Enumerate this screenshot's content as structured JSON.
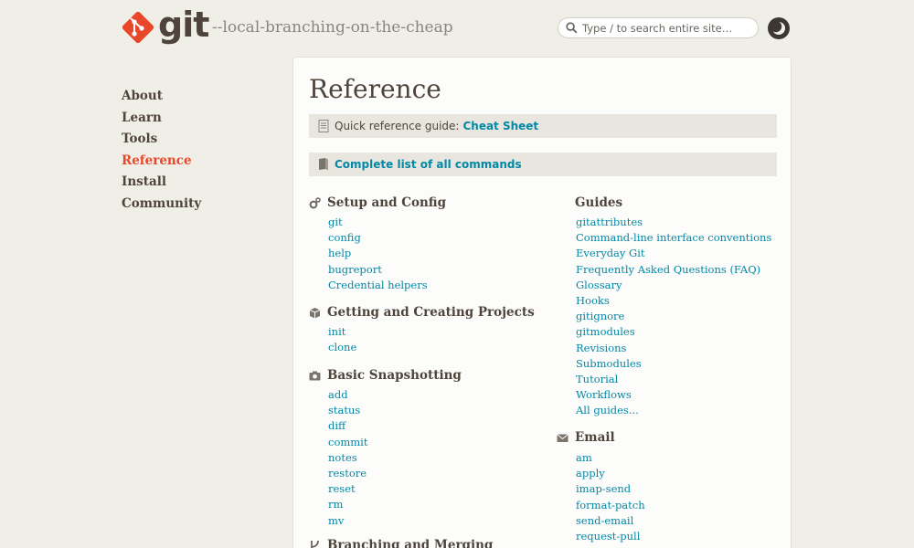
{
  "header": {
    "logo_text": "git",
    "tagline": "--local-branching-on-the-cheap",
    "search_placeholder": "Type / to search entire site…"
  },
  "sidebar": {
    "items": [
      {
        "label": "About"
      },
      {
        "label": "Learn"
      },
      {
        "label": "Tools"
      },
      {
        "label": "Reference",
        "active": true
      },
      {
        "label": "Install"
      },
      {
        "label": "Community"
      }
    ]
  },
  "main": {
    "title": "Reference",
    "quick_ref_label": "Quick reference guide:",
    "quick_ref_link": "Cheat Sheet",
    "complete_list_link": "Complete list of all commands",
    "sections": {
      "setup": {
        "title": "Setup and Config",
        "links": [
          "git",
          "config",
          "help",
          "bugreport",
          "Credential helpers"
        ]
      },
      "projects": {
        "title": "Getting and Creating Projects",
        "links": [
          "init",
          "clone"
        ]
      },
      "snapshot": {
        "title": "Basic Snapshotting",
        "links": [
          "add",
          "status",
          "diff",
          "commit",
          "notes",
          "restore",
          "reset",
          "rm",
          "mv"
        ]
      },
      "branching": {
        "title": "Branching and Merging"
      },
      "guides": {
        "title": "Guides",
        "links": [
          "gitattributes",
          "Command-line interface conventions",
          "Everyday Git",
          "Frequently Asked Questions (FAQ)",
          "Glossary",
          "Hooks",
          "gitignore",
          "gitmodules",
          "Revisions",
          "Submodules",
          "Tutorial",
          "Workflows",
          "All guides..."
        ]
      },
      "email": {
        "title": "Email",
        "links": [
          "am",
          "apply",
          "imap-send",
          "format-patch",
          "send-email",
          "request-pull"
        ]
      }
    }
  },
  "colors": {
    "background": "#f0efe7",
    "accent": "#e9472a",
    "link": "#0388a6",
    "text": "#4e443c"
  }
}
